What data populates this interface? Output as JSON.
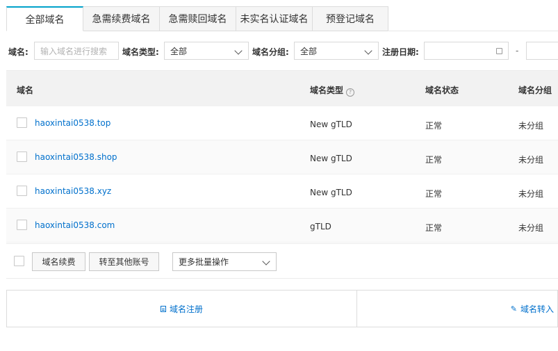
{
  "tabs": [
    {
      "label": "全部域名",
      "active": true
    },
    {
      "label": "急需续费域名",
      "active": false
    },
    {
      "label": "急需赎回域名",
      "active": false
    },
    {
      "label": "未实名认证域名",
      "active": false
    },
    {
      "label": "预登记域名",
      "active": false
    }
  ],
  "filters": {
    "domain_label": "域名:",
    "domain_placeholder": "输入域名进行搜索",
    "type_label": "域名类型:",
    "type_value": "全部",
    "group_label": "域名分组:",
    "group_value": "全部",
    "date_label": "注册日期:",
    "date_separator": "-"
  },
  "table": {
    "headers": {
      "domain": "域名",
      "type": "域名类型",
      "status": "域名状态",
      "group": "域名分组"
    },
    "rows": [
      {
        "domain": "haoxintai0538.top",
        "type": "New gTLD",
        "status": "正常",
        "group": "未分组"
      },
      {
        "domain": "haoxintai0538.shop",
        "type": "New gTLD",
        "status": "正常",
        "group": "未分组"
      },
      {
        "domain": "haoxintai0538.xyz",
        "type": "New gTLD",
        "status": "正常",
        "group": "未分组"
      },
      {
        "domain": "haoxintai0538.com",
        "type": "gTLD",
        "status": "正常",
        "group": "未分组"
      }
    ]
  },
  "footer": {
    "renew_button": "域名续费",
    "transfer_button": "转至其他账号",
    "bulk_select": "更多批量操作"
  },
  "actions": {
    "register": "域名注册",
    "transfer_in": "域名转入"
  },
  "colors": {
    "accent": "#00a2ca",
    "link": "#0070cc"
  },
  "icons": {
    "help": "question-circle-icon",
    "calendar": "calendar-icon",
    "register": "document-icon",
    "transfer_in": "pencil-icon"
  }
}
